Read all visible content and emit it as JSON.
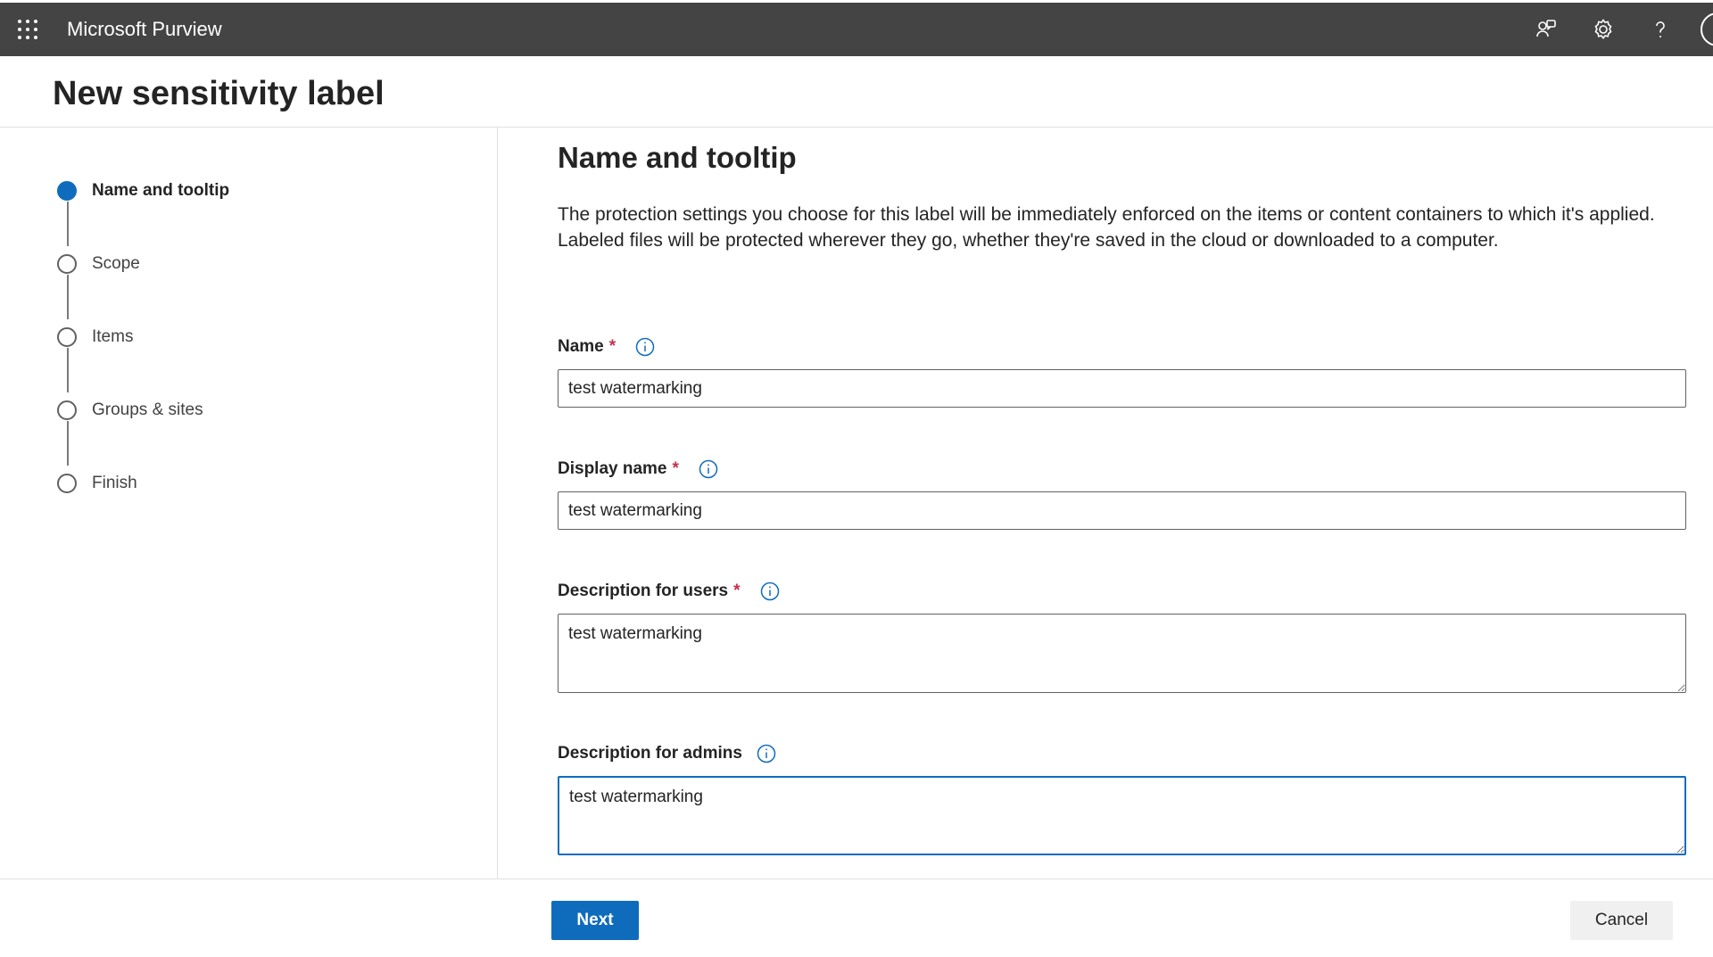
{
  "app": {
    "title": "Microsoft Purview",
    "header_icons": [
      "app-launcher-icon",
      "feedback-icon",
      "settings-icon",
      "help-icon",
      "avatar"
    ],
    "colors": {
      "topbar": "#444444",
      "accent": "#0f6cbd",
      "required": "#c4314b"
    }
  },
  "page": {
    "title": "New sensitivity label"
  },
  "steps": [
    {
      "label": "Name and tooltip",
      "status": "current"
    },
    {
      "label": "Scope",
      "status": "pending"
    },
    {
      "label": "Items",
      "status": "pending"
    },
    {
      "label": "Groups & sites",
      "status": "pending"
    },
    {
      "label": "Finish",
      "status": "pending"
    }
  ],
  "content": {
    "title": "Name and tooltip",
    "description": "The protection settings you choose for this label will be immediately enforced on the items or content containers to which it's applied. Labeled files will be protected wherever they go, whether they're saved in the cloud or downloaded to a computer.",
    "fields": {
      "name": {
        "label": "Name",
        "required_mark": "*",
        "value": "test watermarking"
      },
      "display_name": {
        "label": "Display name",
        "required_mark": "*",
        "value": "test watermarking"
      },
      "description_users": {
        "label": "Description for users",
        "required_mark": "*",
        "value": "test watermarking"
      },
      "description_admins": {
        "label": "Description for admins",
        "value": "test watermarking"
      }
    }
  },
  "footer": {
    "next_label": "Next",
    "cancel_label": "Cancel"
  }
}
